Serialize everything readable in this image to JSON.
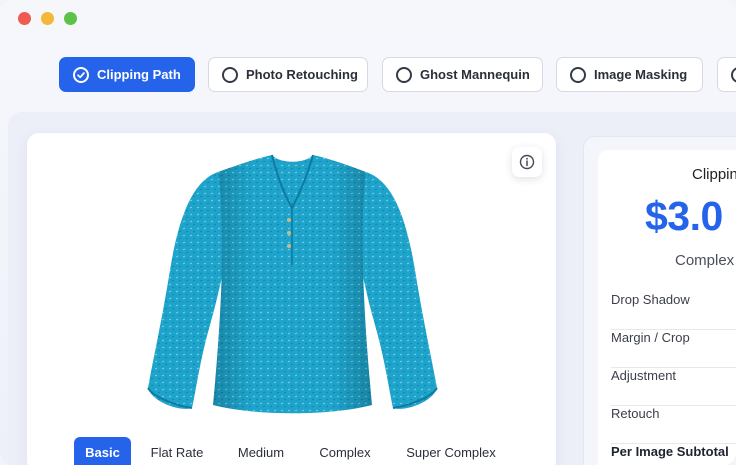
{
  "window": {
    "traffic_lights": [
      "close",
      "minimize",
      "zoom"
    ],
    "colors": {
      "close": "#ef5a52",
      "minimize": "#f4b73a",
      "zoom": "#5dc347"
    }
  },
  "service_tabs": [
    {
      "label": "Clipping Path",
      "selected": true
    },
    {
      "label": "Photo Retouching",
      "selected": false
    },
    {
      "label": "Ghost Mannequin",
      "selected": false
    },
    {
      "label": "Image Masking",
      "selected": false
    }
  ],
  "complexity_tabs": [
    {
      "label": "Basic",
      "selected": true
    },
    {
      "label": "Flat Rate",
      "selected": false
    },
    {
      "label": "Medium",
      "selected": false
    },
    {
      "label": "Complex",
      "selected": false
    },
    {
      "label": "Super Complex",
      "selected": false
    }
  ],
  "preview": {
    "image": "turquoise-long-sleeve-blouse",
    "info_icon": "info-icon"
  },
  "pricing": {
    "title": "Clippin",
    "price": "$3.0",
    "level": "Complex",
    "rows": [
      "Drop Shadow",
      "Margin / Crop",
      "Adjustment",
      "Retouch"
    ],
    "subtotal_label": "Per Image Subtotal"
  },
  "colors": {
    "accent": "#2563eb",
    "product": "#1da3c9"
  }
}
